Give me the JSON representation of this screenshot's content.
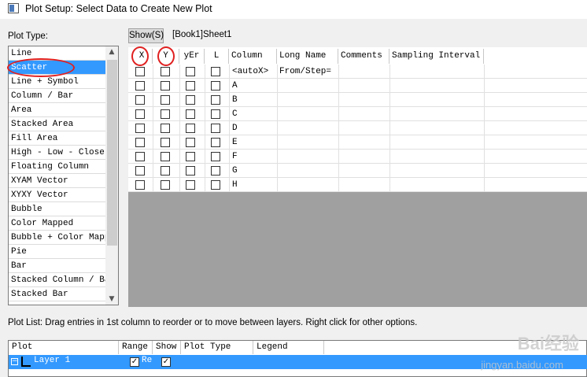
{
  "window": {
    "title": "Plot Setup: Select Data to Create New Plot"
  },
  "plot_type": {
    "label": "Plot Type:",
    "items": [
      "Line",
      "Scatter",
      "Line + Symbol",
      "Column / Bar",
      "Area",
      "Stacked Area",
      "Fill Area",
      "High - Low - Close",
      "Floating Column",
      "XYAM Vector",
      "XYXY Vector",
      "Bubble",
      "Color Mapped",
      "Bubble + Color Mappe",
      "Pie",
      "Bar",
      "Stacked Column / Bar",
      "Stacked Bar"
    ],
    "selected": "Scatter"
  },
  "data_panel": {
    "show_button": "Show(S)",
    "source": "[Book1]Sheet1",
    "headers": [
      "X",
      "Y",
      "yEr",
      "L",
      "Column",
      "Long Name",
      "Comments",
      "Sampling Interval"
    ],
    "rows": [
      {
        "column": "<autoX>",
        "long_name": "From/Step="
      },
      {
        "column": "A",
        "long_name": ""
      },
      {
        "column": "B",
        "long_name": ""
      },
      {
        "column": "C",
        "long_name": ""
      },
      {
        "column": "D",
        "long_name": ""
      },
      {
        "column": "E",
        "long_name": ""
      },
      {
        "column": "F",
        "long_name": ""
      },
      {
        "column": "G",
        "long_name": ""
      },
      {
        "column": "H",
        "long_name": ""
      }
    ]
  },
  "plot_list": {
    "label": "Plot List: Drag entries in 1st column to reorder or to move between layers. Right click for other options.",
    "headers": [
      "Plot",
      "Range",
      "Show",
      "Plot Type",
      "Legend"
    ],
    "rows": [
      {
        "plot": "Layer 1",
        "range": "Re",
        "range_checked": true,
        "show_checked": true
      }
    ]
  },
  "watermark": {
    "brand": "Bai经验",
    "url": "jingyan.baidu.com"
  },
  "colors": {
    "selection": "#3399ff",
    "annotation": "#e02020",
    "empty_area": "#a0a0a0"
  }
}
